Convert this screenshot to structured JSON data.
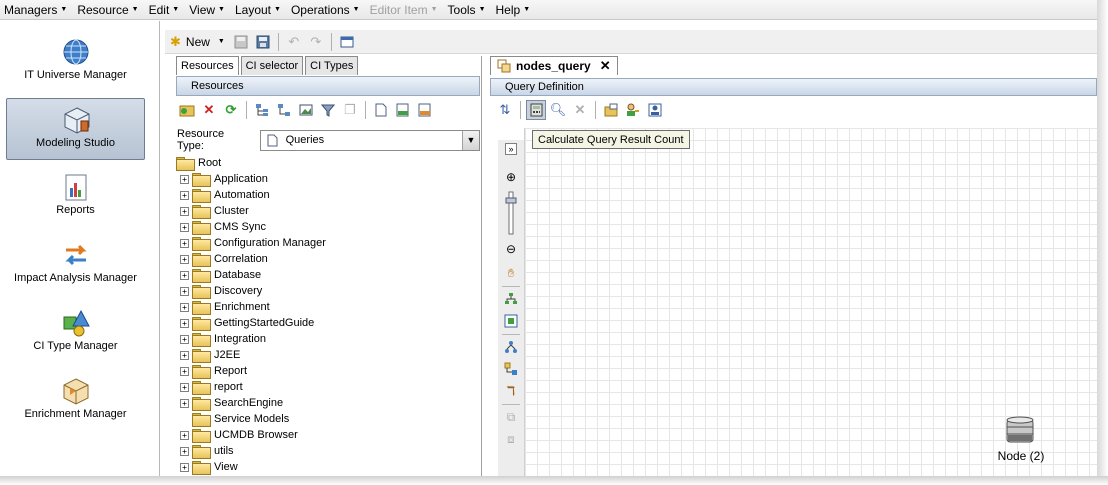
{
  "menubar": {
    "items": [
      {
        "label": "Managers",
        "enabled": true
      },
      {
        "label": "Resource",
        "enabled": true
      },
      {
        "label": "Edit",
        "enabled": true
      },
      {
        "label": "View",
        "enabled": true
      },
      {
        "label": "Layout",
        "enabled": true
      },
      {
        "label": "Operations",
        "enabled": true
      },
      {
        "label": "Editor Item",
        "enabled": false
      },
      {
        "label": "Tools",
        "enabled": true
      },
      {
        "label": "Help",
        "enabled": true
      }
    ]
  },
  "leftnav": {
    "items": [
      {
        "label": "IT Universe Manager",
        "icon": "globe-icon",
        "active": false
      },
      {
        "label": "Modeling Studio",
        "icon": "modeling-cube-icon",
        "active": true
      },
      {
        "label": "Reports",
        "icon": "report-chart-icon",
        "active": false
      },
      {
        "label": "Impact Analysis Manager",
        "icon": "impact-arrows-icon",
        "active": false
      },
      {
        "label": "CI Type Manager",
        "icon": "shapes-icon",
        "active": false
      },
      {
        "label": "Enrichment Manager",
        "icon": "enrichment-cube-icon",
        "active": false
      }
    ]
  },
  "toolbar": {
    "new_label": "New"
  },
  "resources_panel": {
    "tabs": [
      "Resources",
      "CI selector",
      "CI Types"
    ],
    "header": "Resources",
    "resource_type_label": "Resource Type:",
    "resource_type_value": "Queries",
    "tree": {
      "root": "Root",
      "children": [
        {
          "label": "Application",
          "expandable": true
        },
        {
          "label": "Automation",
          "expandable": true
        },
        {
          "label": "Cluster",
          "expandable": true
        },
        {
          "label": "CMS Sync",
          "expandable": true
        },
        {
          "label": "Configuration Manager",
          "expandable": true
        },
        {
          "label": "Correlation",
          "expandable": true
        },
        {
          "label": "Database",
          "expandable": true
        },
        {
          "label": "Discovery",
          "expandable": true
        },
        {
          "label": "Enrichment",
          "expandable": true
        },
        {
          "label": "GettingStartedGuide",
          "expandable": true
        },
        {
          "label": "Integration",
          "expandable": true
        },
        {
          "label": "J2EE",
          "expandable": true
        },
        {
          "label": "Report",
          "expandable": true
        },
        {
          "label": "report",
          "expandable": true
        },
        {
          "label": "SearchEngine",
          "expandable": true
        },
        {
          "label": "Service Models",
          "expandable": false
        },
        {
          "label": "UCMDB Browser",
          "expandable": true
        },
        {
          "label": "utils",
          "expandable": true
        },
        {
          "label": "View",
          "expandable": true
        }
      ]
    }
  },
  "query_panel": {
    "tab_label": "nodes_query",
    "header": "Query Definition",
    "tooltip": "Calculate Query Result Count",
    "node_label": "Node (2)"
  },
  "colors": {
    "accent": "#c9d6e7",
    "nav_active": "#b7c3d3",
    "folder": "#e8c35a"
  }
}
